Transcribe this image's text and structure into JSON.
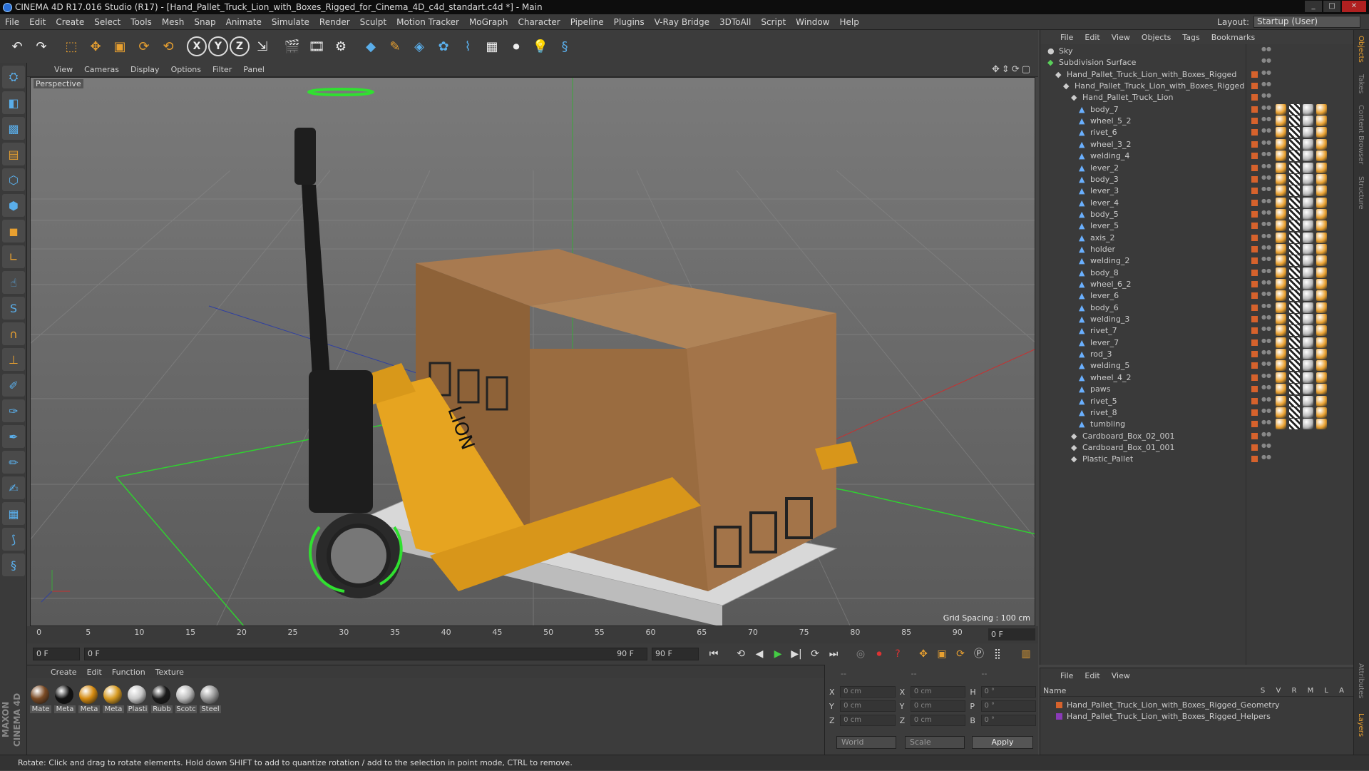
{
  "window": {
    "title": "CINEMA 4D R17.016 Studio (R17) - [Hand_Pallet_Truck_Lion_with_Boxes_Rigged_for_Cinema_4D_c4d_standart.c4d *] - Main"
  },
  "menubar": {
    "items": [
      "File",
      "Edit",
      "Create",
      "Select",
      "Tools",
      "Mesh",
      "Snap",
      "Animate",
      "Simulate",
      "Render",
      "Sculpt",
      "Motion Tracker",
      "MoGraph",
      "Character",
      "Pipeline",
      "Plugins",
      "V-Ray Bridge",
      "3DToAll",
      "Script",
      "Window",
      "Help"
    ],
    "layout_label": "Layout:",
    "layout_value": "Startup (User)"
  },
  "viewport": {
    "menu": [
      "View",
      "Cameras",
      "Display",
      "Options",
      "Filter",
      "Panel"
    ],
    "label": "Perspective",
    "grid_spacing": "Grid Spacing : 100 cm"
  },
  "timeline": {
    "ticks": [
      "0",
      "5",
      "10",
      "15",
      "20",
      "25",
      "30",
      "35",
      "40",
      "45",
      "50",
      "55",
      "60",
      "65",
      "70",
      "75",
      "80",
      "85",
      "90"
    ],
    "frame_indicator": "0 F"
  },
  "transport": {
    "start_field": "0 F",
    "slider_start": "0 F",
    "slider_end": "90 F",
    "end_field": "90 F"
  },
  "materials": {
    "menu": [
      "Create",
      "Edit",
      "Function",
      "Texture"
    ],
    "items": [
      {
        "label": "Mate",
        "color": "#7a4a24"
      },
      {
        "label": "Meta",
        "color": "#111111"
      },
      {
        "label": "Meta",
        "color": "#d48a10"
      },
      {
        "label": "Meta",
        "color": "#d69a20"
      },
      {
        "label": "Plasti",
        "color": "#c8c8c8"
      },
      {
        "label": "Rubb",
        "color": "#1a1a1a"
      },
      {
        "label": "Scotc",
        "color": "#bbbbbb"
      },
      {
        "label": "Steel",
        "color": "#9a9a9a"
      }
    ]
  },
  "coords": {
    "headers": [
      "--",
      "--",
      "--"
    ],
    "rows": [
      {
        "a": "X",
        "av": "0 cm",
        "b": "X",
        "bv": "0 cm",
        "c": "H",
        "cv": "0 °"
      },
      {
        "a": "Y",
        "av": "0 cm",
        "b": "Y",
        "bv": "0 cm",
        "c": "P",
        "cv": "0 °"
      },
      {
        "a": "Z",
        "av": "0 cm",
        "b": "Z",
        "bv": "0 cm",
        "c": "B",
        "cv": "0 °"
      }
    ],
    "mode1": "World",
    "mode2": "Scale",
    "apply": "Apply"
  },
  "objects": {
    "menu": [
      "File",
      "Edit",
      "View",
      "Objects",
      "Tags",
      "Bookmarks"
    ],
    "items": [
      {
        "name": "Sky",
        "indent": 0
      },
      {
        "name": "Subdivision Surface",
        "indent": 0
      },
      {
        "name": "Hand_Pallet_Truck_Lion_with_Boxes_Rigged",
        "indent": 1
      },
      {
        "name": "Hand_Pallet_Truck_Lion_with_Boxes_Rigged",
        "indent": 2
      },
      {
        "name": "Hand_Pallet_Truck_Lion",
        "indent": 3
      },
      {
        "name": "body_7",
        "indent": 4
      },
      {
        "name": "wheel_5_2",
        "indent": 4
      },
      {
        "name": "rivet_6",
        "indent": 4
      },
      {
        "name": "wheel_3_2",
        "indent": 4
      },
      {
        "name": "welding_4",
        "indent": 4
      },
      {
        "name": "lever_2",
        "indent": 4
      },
      {
        "name": "body_3",
        "indent": 4
      },
      {
        "name": "lever_3",
        "indent": 4
      },
      {
        "name": "lever_4",
        "indent": 4
      },
      {
        "name": "body_5",
        "indent": 4
      },
      {
        "name": "lever_5",
        "indent": 4
      },
      {
        "name": "axis_2",
        "indent": 4
      },
      {
        "name": "holder",
        "indent": 4
      },
      {
        "name": "welding_2",
        "indent": 4
      },
      {
        "name": "body_8",
        "indent": 4
      },
      {
        "name": "wheel_6_2",
        "indent": 4
      },
      {
        "name": "lever_6",
        "indent": 4
      },
      {
        "name": "body_6",
        "indent": 4
      },
      {
        "name": "welding_3",
        "indent": 4
      },
      {
        "name": "rivet_7",
        "indent": 4
      },
      {
        "name": "lever_7",
        "indent": 4
      },
      {
        "name": "rod_3",
        "indent": 4
      },
      {
        "name": "welding_5",
        "indent": 4
      },
      {
        "name": "wheel_4_2",
        "indent": 4
      },
      {
        "name": "paws",
        "indent": 4
      },
      {
        "name": "rivet_5",
        "indent": 4
      },
      {
        "name": "rivet_8",
        "indent": 4
      },
      {
        "name": "tumbling",
        "indent": 4
      },
      {
        "name": "Cardboard_Box_02_001",
        "indent": 3
      },
      {
        "name": "Cardboard_Box_01_001",
        "indent": 3
      },
      {
        "name": "Plastic_Pallet",
        "indent": 3
      }
    ]
  },
  "layers": {
    "menu": [
      "File",
      "Edit",
      "View"
    ],
    "header_name": "Name",
    "header_cols": "S V R M L A",
    "items": [
      {
        "name": "Hand_Pallet_Truck_Lion_with_Boxes_Rigged_Geometry",
        "color": "#d6622c"
      },
      {
        "name": "Hand_Pallet_Truck_Lion_with_Boxes_Rigged_Helpers",
        "color": "#8a3ab8"
      }
    ]
  },
  "right_tabs": [
    "Objects",
    "Takes",
    "Content Browser",
    "Structure"
  ],
  "right_tabs_lower": [
    "Attributes",
    "Layers"
  ],
  "status": "Rotate: Click and drag to rotate elements. Hold down SHIFT to add to quantize rotation / add to the selection in point mode, CTRL to remove.",
  "branding": "MAXON CINEMA 4D"
}
